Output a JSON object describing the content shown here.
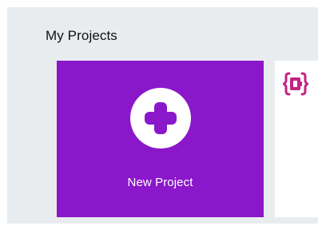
{
  "section": {
    "title": "My Projects"
  },
  "new_project": {
    "label": "New Project",
    "icon": "plus-icon"
  },
  "projects": [
    {
      "icon": "makecode-logo-icon"
    }
  ],
  "colors": {
    "accent": "#8a17c9",
    "background": "#e9ecef",
    "logo": "#c32281"
  }
}
